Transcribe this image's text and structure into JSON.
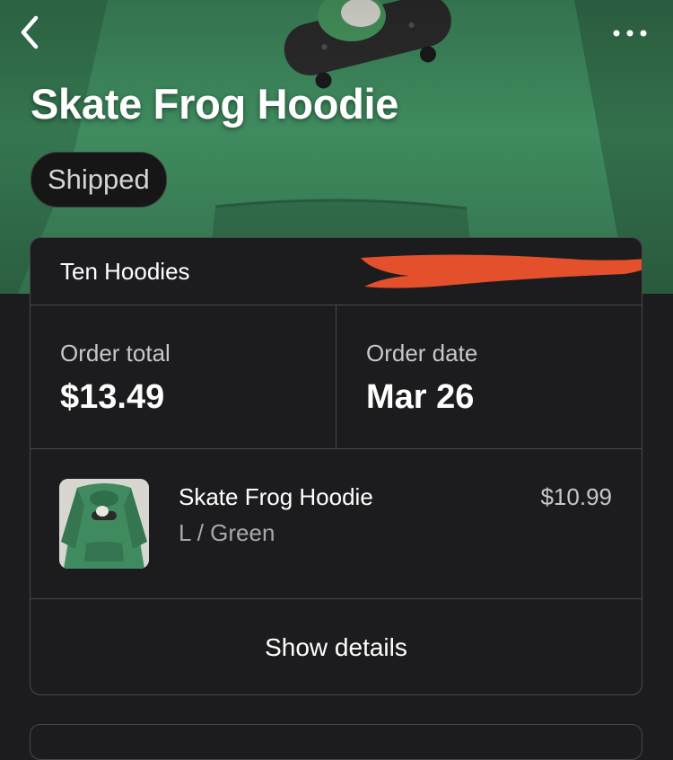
{
  "header": {
    "title": "Skate Frog Hoodie",
    "status": "Shipped"
  },
  "icons": {
    "back": "chevron-left-icon",
    "more": "more-horizontal-icon"
  },
  "order": {
    "store_name": "Ten Hoodies",
    "total_label": "Order total",
    "total_value": "$13.49",
    "date_label": "Order date",
    "date_value": "Mar 26"
  },
  "item": {
    "name": "Skate Frog Hoodie",
    "variant": "L / Green",
    "price": "$10.99"
  },
  "actions": {
    "show_details": "Show details"
  },
  "colors": {
    "background": "#1c1c1e",
    "hoodie_green": "#3c8059",
    "redaction": "#e4502c"
  }
}
